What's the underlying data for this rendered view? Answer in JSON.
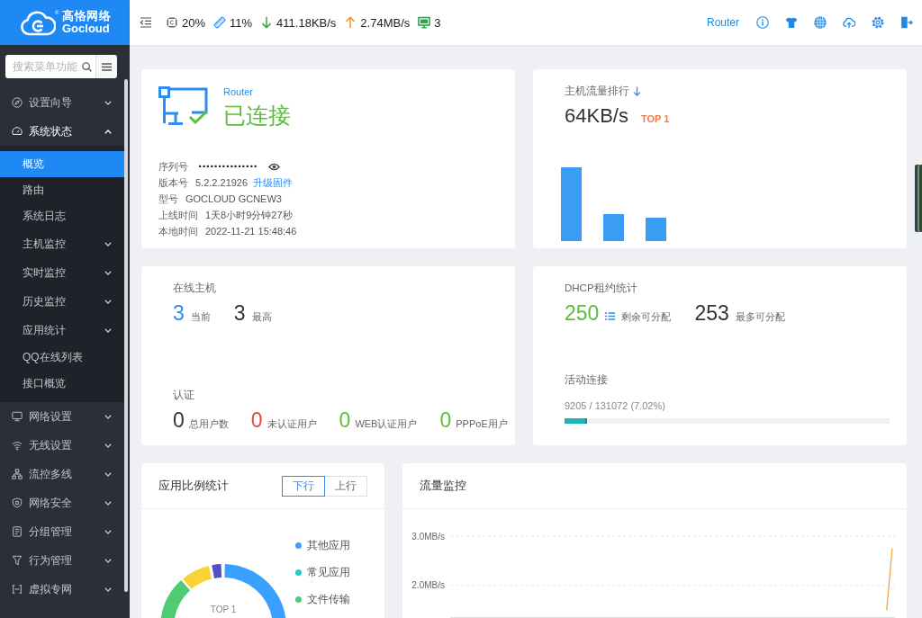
{
  "logo": {
    "title": "高恪网络",
    "subtitle": "Gocloud",
    "mark": "®"
  },
  "top_bar": {
    "stats": [
      {
        "kind": "cpu",
        "value": "20%"
      },
      {
        "kind": "memory",
        "value": "11%"
      },
      {
        "kind": "download",
        "value": "411.18KB/s"
      },
      {
        "kind": "upload",
        "value": "2.74MB/s"
      },
      {
        "kind": "hosts",
        "value": "3"
      }
    ],
    "device_link": "Router"
  },
  "sidebar": {
    "search": {
      "placeholder": "搜索菜单功能"
    },
    "items": [
      {
        "label": "设置向导",
        "expanded": false
      },
      {
        "label": "系统状态",
        "expanded": true,
        "children": [
          {
            "kind": "link",
            "label": "概览",
            "selected": true
          },
          {
            "kind": "link",
            "label": "路由",
            "selected": false
          },
          {
            "kind": "link",
            "label": "系统日志",
            "selected": false
          },
          {
            "kind": "group",
            "label": "主机监控",
            "selected": false,
            "expanded": false
          },
          {
            "kind": "group",
            "label": "实时监控",
            "selected": false,
            "expanded": false
          },
          {
            "kind": "group",
            "label": "历史监控",
            "selected": false,
            "expanded": false
          },
          {
            "kind": "group",
            "label": "应用统计",
            "selected": false,
            "expanded": false
          },
          {
            "kind": "link",
            "label": "QQ在线列表",
            "selected": false
          },
          {
            "kind": "link",
            "label": "接口概览",
            "selected": false
          }
        ]
      },
      {
        "label": "网络设置",
        "expanded": false
      },
      {
        "label": "无线设置",
        "expanded": false
      },
      {
        "label": "流控多线",
        "expanded": false
      },
      {
        "label": "网络安全",
        "expanded": false
      },
      {
        "label": "分组管理",
        "expanded": false
      },
      {
        "label": "行为管理",
        "expanded": false
      },
      {
        "label": "虚拟专网",
        "expanded": false
      }
    ]
  },
  "device_card": {
    "model": "Router",
    "status": {
      "text": "已连接",
      "connected": true
    },
    "info": [
      {
        "kind": "masked",
        "label": "序列号",
        "value": "···············"
      },
      {
        "kind": "text",
        "label": "版本号",
        "value": "5.2.2.21926",
        "link": "升级固件"
      },
      {
        "kind": "text",
        "label": "型号",
        "value": "GOCLOUD GCNEW3"
      },
      {
        "kind": "text",
        "label": "上线时间",
        "value": "1天8小时9分钟27秒"
      },
      {
        "kind": "text",
        "label": "本地时间",
        "value": "2022-11-21 15:48:46"
      }
    ]
  },
  "traffic_rank_card": {
    "title": "主机流量排行",
    "value": "64KB/s",
    "badge": "TOP 1"
  },
  "online_hosts_card": {
    "title": "在线主机",
    "counts": [
      {
        "value": "3",
        "label": "当前",
        "color": "#2d8cf0"
      },
      {
        "value": "3",
        "label": "最高",
        "color": "#333333"
      }
    ],
    "auth_title": "认证",
    "auth_counts": [
      {
        "value": "0",
        "label": "总用户数",
        "color": "#333333"
      },
      {
        "value": "0",
        "label": "未认证用户",
        "color": "#e8453c"
      },
      {
        "value": "0",
        "label": "WEB认证用户",
        "color": "#5cbd3c"
      },
      {
        "value": "0",
        "label": "PPPoE用户",
        "color": "#5cbd3c"
      }
    ]
  },
  "dhcp_card": {
    "title": "DHCP租约统计",
    "counts": [
      {
        "kind": "remaining",
        "value": "250",
        "label": "剩余可分配",
        "color": "#5cbd3c"
      },
      {
        "kind": "total",
        "value": "253",
        "label": "最多可分配",
        "color": "#333333"
      }
    ],
    "connections": {
      "title": "活动连接",
      "reading": "9205 / 131072 (7.02%)",
      "level": 0.0702
    }
  },
  "app_ratio_card": {
    "title": "应用比例统计",
    "tabs": [
      {
        "label": "下行",
        "selected": true
      },
      {
        "label": "上行",
        "selected": false
      }
    ],
    "legend": [
      {
        "label": "其他应用",
        "color": "#3aa0ff"
      },
      {
        "label": "常见应用",
        "color": "#2ec7c9"
      },
      {
        "label": "文件传输",
        "color": "#4ecb73"
      }
    ],
    "center_label": "TOP 1"
  },
  "traffic_monitor_card": {
    "title": "流量监控",
    "chart_data": {
      "type": "line",
      "categories": [
        null,
        null,
        null,
        null,
        null,
        null,
        null,
        null,
        null,
        null,
        null,
        null,
        null,
        null,
        null,
        null,
        null,
        null,
        null,
        null,
        null,
        null,
        null,
        null,
        null,
        null,
        null,
        null,
        null,
        null,
        null,
        null,
        null,
        null,
        null,
        null,
        null,
        null,
        null,
        null,
        null,
        null,
        null,
        null,
        null,
        null,
        null,
        null,
        null,
        null,
        null,
        null,
        null,
        null,
        null,
        null,
        null,
        null,
        null,
        null,
        null,
        null,
        null,
        null,
        null,
        null,
        null,
        null,
        null,
        null,
        null,
        null,
        null,
        null,
        null,
        null,
        null,
        null,
        null,
        null
      ],
      "ylim": [
        1.35,
        3
      ],
      "yticks": [
        {
          "value": 2,
          "label": "2.0MB/s"
        },
        {
          "value": 3,
          "label": "3.0MB/s"
        }
      ],
      "series": [
        {
          "color": "#f0a848",
          "values": [
            null,
            null,
            null,
            null,
            null,
            null,
            null,
            null,
            null,
            null,
            null,
            null,
            null,
            null,
            null,
            null,
            null,
            null,
            null,
            null,
            null,
            null,
            null,
            null,
            null,
            null,
            null,
            null,
            null,
            null,
            null,
            null,
            null,
            null,
            null,
            null,
            null,
            null,
            null,
            null,
            null,
            null,
            null,
            null,
            null,
            null,
            null,
            null,
            null,
            null,
            null,
            null,
            null,
            null,
            null,
            null,
            null,
            null,
            null,
            null,
            null,
            null,
            null,
            null,
            null,
            null,
            null,
            null,
            null,
            null,
            null,
            null,
            null,
            null,
            null,
            null,
            null,
            null,
            1.5,
            2.75
          ]
        }
      ]
    }
  }
}
